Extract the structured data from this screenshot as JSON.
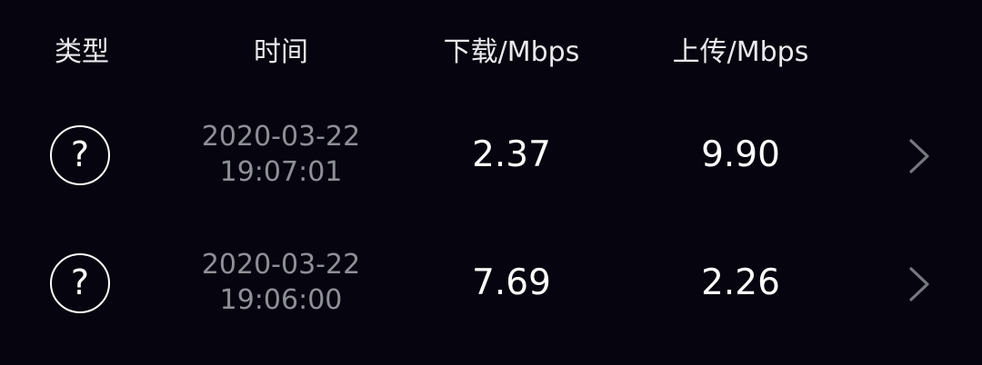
{
  "header": {
    "type_label": "类型",
    "time_label": "时间",
    "download_label": "下载/Mbps",
    "upload_label": "上传/Mbps"
  },
  "rows": [
    {
      "type_icon": "question-mark-circle-icon",
      "type_glyph": "?",
      "date": "2020-03-22",
      "time": "19:07:01",
      "download": "2.37",
      "upload": "9.90"
    },
    {
      "type_icon": "question-mark-circle-icon",
      "type_glyph": "?",
      "date": "2020-03-22",
      "time": "19:06:00",
      "download": "7.69",
      "upload": "2.26"
    }
  ],
  "colors": {
    "background": "#06050f",
    "primary_text": "#ffffff",
    "header_text": "#e9e9ee",
    "secondary_text": "#8f8f98",
    "chevron": "#77777f"
  }
}
